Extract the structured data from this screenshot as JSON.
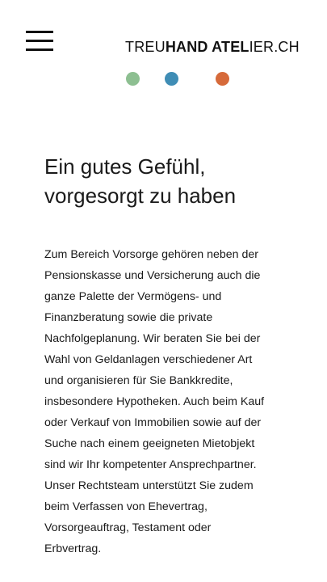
{
  "header": {
    "menu_icon": "hamburger-menu-icon",
    "logo": {
      "part1": "TREU",
      "part2": "HAND ATEL",
      "part3": "IER.CH"
    },
    "dots": [
      {
        "name": "green-dot",
        "color": "#8dbf91"
      },
      {
        "name": "blue-dot",
        "color": "#3f8db5"
      },
      {
        "name": "orange-dot",
        "color": "#d66a3a"
      }
    ]
  },
  "main": {
    "headline_line1": "Ein gutes Gefühl,",
    "headline_line2": "vorgesorgt zu haben",
    "body_lines": [
      "Zum Bereich Vorsorge gehören neben der",
      "Pensionskasse und Versicherung auch die",
      "ganze Palette der Vermögens- und",
      "Finanzberatung sowie die private",
      "Nachfolgeplanung. Wir beraten Sie bei der",
      "Wahl von Geldanlagen verschiedener Art",
      "und organisieren für Sie Bankkredite,",
      "insbesondere Hypotheken. Auch beim Kauf",
      "oder Verkauf von Immobilien sowie auf der",
      "Suche nach einem geeigneten Mietobjekt",
      "sind wir Ihr kompetenter Ansprechpartner.",
      "Unser Rechtsteam unterstützt Sie zudem",
      "beim Verfassen von Ehevertrag,",
      "Vorsorgeauftrag, Testament oder",
      "Erbvertrag."
    ]
  }
}
